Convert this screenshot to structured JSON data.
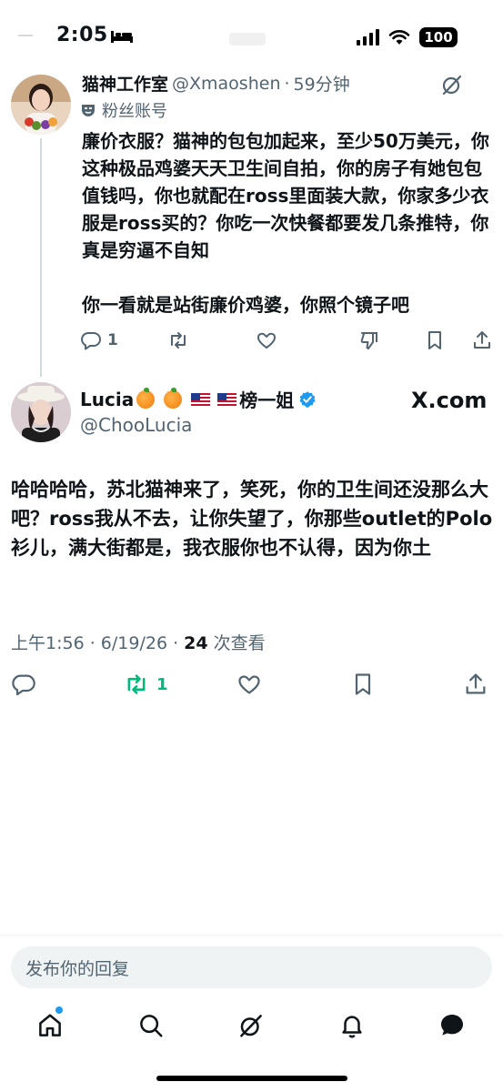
{
  "status_bar": {
    "time": "2:05",
    "battery": "100"
  },
  "reply_tweet": {
    "display_name": "猫神工作室",
    "handle": "@Xmaoshen",
    "separator": "·",
    "time_ago": "59分钟",
    "account_tag": "粉丝账号",
    "text_paragraph_1": "廉价衣服？猫神的包包加起来，至少50万美元，你这种极品鸡婆天天卫生间自拍，你的房子有她包包值钱吗，你也就配在ross里面装大款，你家多少衣服是ross买的？你吃一次快餐都要发几条推特，你真是穷逼不自知",
    "text_paragraph_2": "你一看就是站街廉价鸡婆，你照个镜子吧",
    "reply_count": "1"
  },
  "main_tweet": {
    "display_name": "Lucia",
    "name_suffix": "榜一姐",
    "handle": "@ChooLucia",
    "brand": "X.com",
    "text": "哈哈哈哈，苏北猫神来了，笑死，你的卫生间还没那么大吧？ross我从不去，让你失望了，你那些outlet的Polo衫儿，满大街都是，我衣服你也不认得，因为你土",
    "meta_time": "上午1:56 · 6/19/26 · ",
    "view_count": "24",
    "view_label": " 次查看",
    "retweet_count": "1"
  },
  "composer": {
    "placeholder": "发布你的回复"
  },
  "colors": {
    "accent": "#1d9bf0",
    "retweet_green": "#00ba7c",
    "text_secondary": "#536471",
    "verified": "#1d9bf0"
  },
  "icons": {
    "reply": "reply-icon",
    "retweet": "retweet-icon",
    "like": "heart-icon",
    "dislike": "dislike-icon",
    "bookmark": "bookmark-icon",
    "share": "share-icon",
    "grok": "grok-icon",
    "tabs": [
      "home-icon",
      "search-icon",
      "grok-icon",
      "notifications-icon",
      "messages-icon"
    ]
  }
}
